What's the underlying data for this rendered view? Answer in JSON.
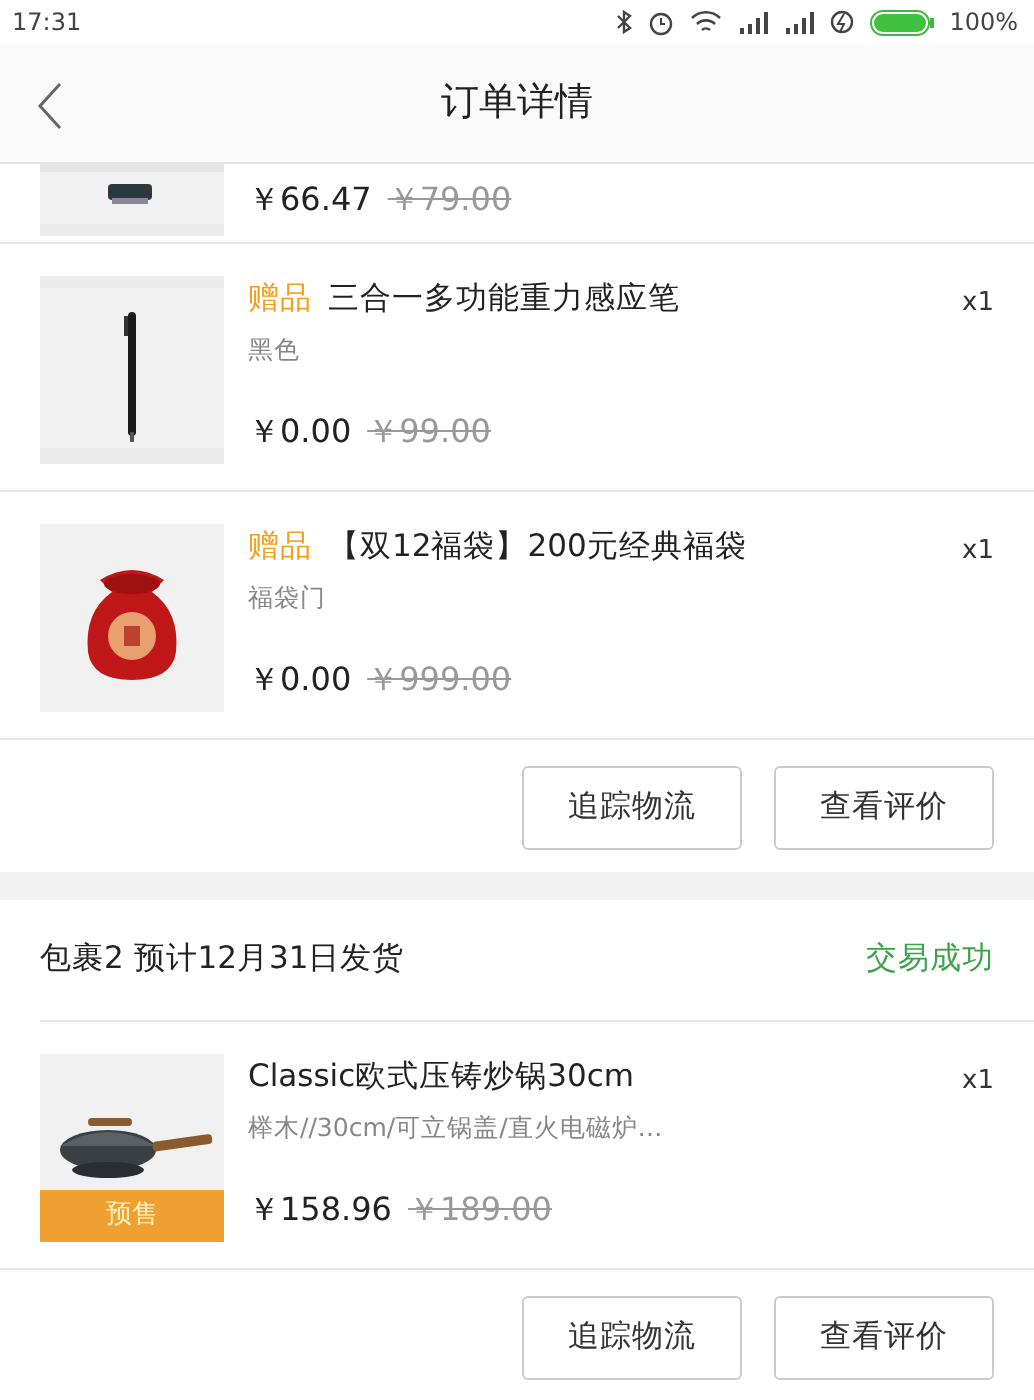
{
  "status_bar": {
    "time": "17:31",
    "battery": "100%"
  },
  "header": {
    "title": "订单详情"
  },
  "packages": [
    {
      "items": [
        {
          "partial": true,
          "price": "￥66.47",
          "original_price": "￥79.00"
        },
        {
          "gift_tag": "赠品",
          "name": "三合一多功能重力感应笔",
          "spec": "黑色",
          "price": "￥0.00",
          "original_price": "￥99.00",
          "quantity": "x1"
        },
        {
          "gift_tag": "赠品",
          "name": "【双12福袋】200元经典福袋",
          "spec": "福袋门",
          "price": "￥0.00",
          "original_price": "￥999.00",
          "quantity": "x1"
        }
      ],
      "actions": [
        "追踪物流",
        "查看评价"
      ]
    },
    {
      "label": "包裹2  预计12月31日发货",
      "status": "交易成功",
      "items": [
        {
          "name": "Classic欧式压铸炒锅30cm",
          "spec": "榉木//30cm/可立锅盖/直火电磁炉…",
          "price": "￥158.96",
          "original_price": "￥189.00",
          "quantity": "x1",
          "badge": "预售"
        }
      ],
      "actions": [
        "追踪物流",
        "查看评价"
      ]
    }
  ]
}
